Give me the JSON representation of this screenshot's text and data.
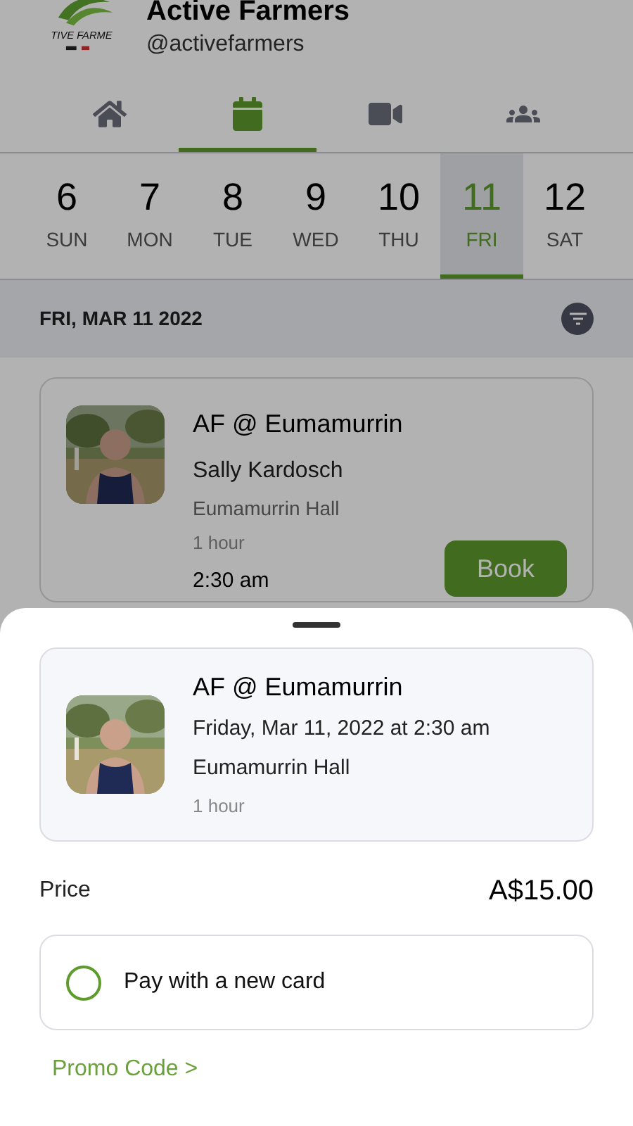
{
  "profile": {
    "logo_text": "TIVE FARME",
    "name": "Active Farmers",
    "handle": "@activefarmers"
  },
  "tabs": [
    {
      "kind": "home",
      "selected": false
    },
    {
      "kind": "calendar",
      "selected": true
    },
    {
      "kind": "video",
      "selected": false
    },
    {
      "kind": "community",
      "selected": false
    }
  ],
  "days": [
    {
      "number": "6",
      "weekday": "SUN",
      "selected": false
    },
    {
      "number": "7",
      "weekday": "MON",
      "selected": false
    },
    {
      "number": "8",
      "weekday": "TUE",
      "selected": false
    },
    {
      "number": "9",
      "weekday": "WED",
      "selected": false
    },
    {
      "number": "10",
      "weekday": "THU",
      "selected": false
    },
    {
      "number": "11",
      "weekday": "FRI",
      "selected": true
    },
    {
      "number": "12",
      "weekday": "SAT",
      "selected": false
    }
  ],
  "date_heading": "FRI, MAR 11 2022",
  "class_card": {
    "title": "AF @ Eumamurrin",
    "instructor": "Sally Kardosch",
    "location": "Eumamurrin Hall",
    "duration": "1 hour",
    "time": "2:30 am",
    "button": "Book"
  },
  "sheet": {
    "summary": {
      "title": "AF @ Eumamurrin",
      "when": "Friday, Mar 11, 2022 at 2:30 am",
      "location": "Eumamurrin Hall",
      "duration": "1 hour"
    },
    "price_label": "Price",
    "price": "A$15.00",
    "payment": {
      "label": "Pay with a new card",
      "selected": false
    },
    "promo": "Promo Code >"
  }
}
